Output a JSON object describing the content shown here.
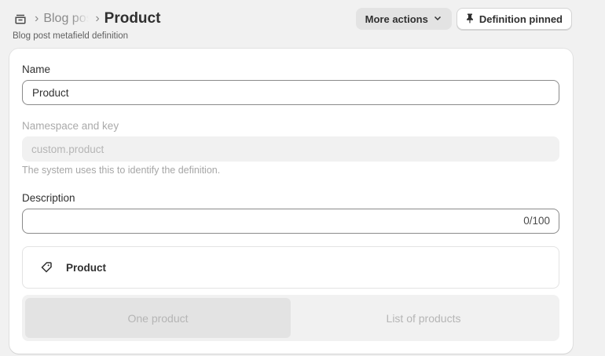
{
  "breadcrumb": {
    "home_icon": "metafields-icon",
    "separator": "›",
    "parent": "Blog post",
    "current": "Product"
  },
  "header": {
    "subtitle": "Blog post metafield definition",
    "more_actions_label": "More actions",
    "more_actions_icon": "chevron-down-icon",
    "pin_label": "Definition pinned",
    "pin_icon": "pin-icon"
  },
  "form": {
    "name_label": "Name",
    "name_value": "Product",
    "namespace_label": "Namespace and key",
    "namespace_value": "custom.product",
    "namespace_help": "The system uses this to identify the definition.",
    "description_label": "Description",
    "description_value": "",
    "description_counter": "0/100",
    "type_icon": "product-icon",
    "type_label": "Product",
    "segments": [
      {
        "label": "One product",
        "selected": true
      },
      {
        "label": "List of products",
        "selected": false
      }
    ]
  },
  "colors": {
    "page_bg": "#f1f1f1",
    "card_bg": "#ffffff",
    "text": "#303030",
    "muted_text": "#b5b5b5",
    "border": "#8a8a8a"
  }
}
